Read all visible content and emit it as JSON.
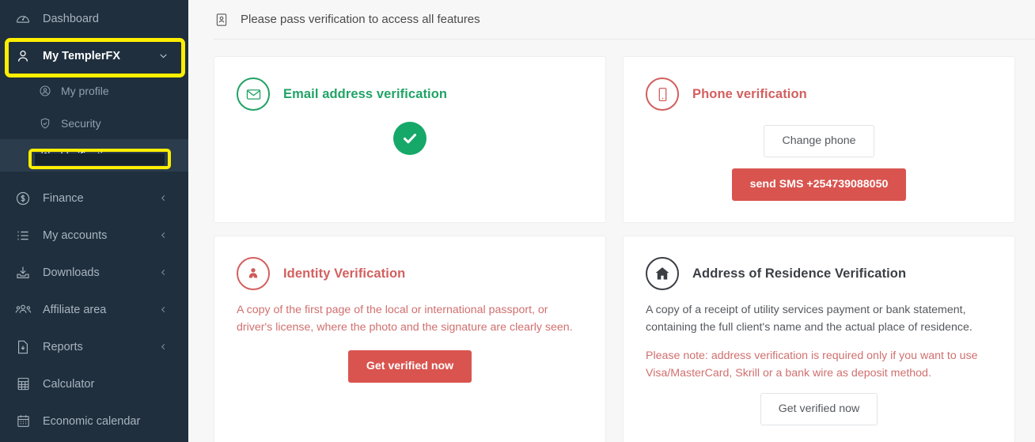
{
  "sidebar": {
    "items": [
      {
        "label": "Dashboard",
        "icon": "dashboard-gauge-icon",
        "chevron": false,
        "state": "normal"
      },
      {
        "label": "My TemplerFX",
        "icon": "user-icon",
        "chevron": true,
        "chevron_dir": "down",
        "state": "active-parent",
        "highlighted": true
      },
      {
        "label": "Finance",
        "icon": "dollar-circle-icon",
        "chevron": true,
        "chevron_dir": "left",
        "state": "normal"
      },
      {
        "label": "My accounts",
        "icon": "list-icon",
        "chevron": true,
        "chevron_dir": "left",
        "state": "normal"
      },
      {
        "label": "Downloads",
        "icon": "download-icon",
        "chevron": true,
        "chevron_dir": "left",
        "state": "normal"
      },
      {
        "label": "Affiliate area",
        "icon": "users-group-icon",
        "chevron": true,
        "chevron_dir": "left",
        "state": "normal"
      },
      {
        "label": "Reports",
        "icon": "report-file-icon",
        "chevron": true,
        "chevron_dir": "left",
        "state": "normal"
      },
      {
        "label": "Calculator",
        "icon": "calculator-icon",
        "chevron": false,
        "state": "normal"
      },
      {
        "label": "Economic calendar",
        "icon": "calendar-icon",
        "chevron": false,
        "state": "normal"
      }
    ],
    "sub_items": [
      {
        "label": "My profile",
        "icon": "user-circle-icon",
        "current": false
      },
      {
        "label": "Security",
        "icon": "shield-icon",
        "current": false
      },
      {
        "label": "Verification",
        "icon": "id-badge-icon",
        "current": true,
        "highlighted": true
      }
    ]
  },
  "topbar": {
    "icon": "id-badge-icon",
    "title": "Please pass verification to access all features"
  },
  "cards": {
    "email": {
      "icon": "envelope-icon",
      "title": "Email address verification",
      "status_icon": "check-circle-icon",
      "status": "verified",
      "accent": "#21a366"
    },
    "phone": {
      "icon": "mobile-phone-icon",
      "title": "Phone verification",
      "change_button": "Change phone",
      "send_sms_button": "send SMS +254739088050",
      "accent": "#d2605f"
    },
    "identity": {
      "icon": "person-suit-icon",
      "title": "Identity Verification",
      "description": "A copy of the first page of the local or international passport, or driver's license, where the photo and the signature are clearly seen.",
      "button": "Get verified now",
      "accent": "#d2605f"
    },
    "address": {
      "icon": "home-icon",
      "title": "Address of Residence Verification",
      "description": "A copy of a receipt of utility services payment or bank statement, containing the full client's name and the actual place of residence.",
      "note": "Please note: address verification is required only if you want to use Visa/MasterCard, Skrill or a bank wire as deposit method.",
      "button": "Get verified now",
      "accent": "#3b3f44"
    }
  },
  "colors": {
    "sidebar_bg": "#1f2f3e",
    "sidebar_active_row": "#2b3c4c",
    "highlight": "#ffee00",
    "green": "#16a869",
    "red": "#d9544f",
    "page_bg": "#f7f7f8"
  }
}
